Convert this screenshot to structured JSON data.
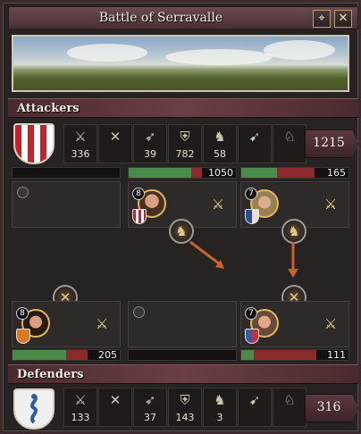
{
  "window": {
    "title": "Battle of Serravalle"
  },
  "titlebar_buttons": [
    {
      "icon": "locate-icon",
      "glyph": "⌖"
    },
    {
      "icon": "close-icon",
      "glyph": "✕"
    }
  ],
  "attackers": {
    "label": "Attackers",
    "total": "1215",
    "stats": [
      {
        "icon": "infantry-icon",
        "glyph": "⚔",
        "value": "336"
      },
      {
        "icon": "pikemen-icon",
        "glyph": "✕",
        "value": ""
      },
      {
        "icon": "archers-icon",
        "glyph": "➶",
        "value": "39"
      },
      {
        "icon": "heavy-infantry-icon",
        "glyph": "⛨",
        "value": "782"
      },
      {
        "icon": "light-cavalry-icon",
        "glyph": "♞",
        "value": "58"
      },
      {
        "icon": "horse-archers-icon",
        "glyph": "➹",
        "value": ""
      },
      {
        "icon": "knights-icon",
        "glyph": "♘",
        "value": ""
      }
    ],
    "flanks": [
      {
        "hp": "",
        "fill": 0.0,
        "commander": false
      },
      {
        "hp": "1050",
        "fill": 0.72,
        "commander": true,
        "level": "8"
      },
      {
        "hp": "165",
        "fill": 0.35,
        "commander": true,
        "level": "7"
      }
    ]
  },
  "defenders": {
    "label": "Defenders",
    "total": "316",
    "stats": [
      {
        "icon": "infantry-icon",
        "glyph": "⚔",
        "value": "133"
      },
      {
        "icon": "pikemen-icon",
        "glyph": "✕",
        "value": ""
      },
      {
        "icon": "archers-icon",
        "glyph": "➶",
        "value": "37"
      },
      {
        "icon": "heavy-infantry-icon",
        "glyph": "⛨",
        "value": "143"
      },
      {
        "icon": "light-cavalry-icon",
        "glyph": "♞",
        "value": "3"
      },
      {
        "icon": "horse-archers-icon",
        "glyph": "➹",
        "value": ""
      },
      {
        "icon": "knights-icon",
        "glyph": "♘",
        "value": ""
      }
    ],
    "flanks": [
      {
        "hp": "205",
        "fill": 0.55,
        "commander": true,
        "level": "8"
      },
      {
        "hp": "",
        "fill": 0.0,
        "commander": false
      },
      {
        "hp": "111",
        "fill": 0.2,
        "commander": true,
        "level": "7"
      }
    ]
  },
  "colors": {
    "hp_green": "#4a8a4a",
    "hp_red": "#8a2a2a",
    "arrow": "#c8602a"
  }
}
